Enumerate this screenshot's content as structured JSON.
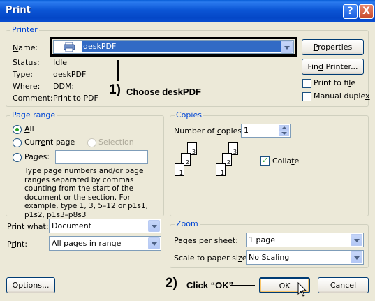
{
  "window": {
    "title": "Print",
    "help_glyph": "?",
    "close_glyph": "X"
  },
  "printer": {
    "group_label": "Printer",
    "name_label": "Name:",
    "name_value": "deskPDF",
    "status_label": "Status:",
    "status_value": "Idle",
    "type_label": "Type:",
    "type_value": "deskPDF",
    "where_label": "Where:",
    "where_value": "DDM:",
    "comment_label": "Comment:",
    "comment_value": "Print to PDF",
    "properties_label": "Properties",
    "find_printer_label": "Find Printer...",
    "print_to_file_label": "Print to file",
    "manual_duplex_label": "Manual duplex"
  },
  "page_range": {
    "group_label": "Page range",
    "all_label": "All",
    "current_page_label": "Current page",
    "selection_label": "Selection",
    "pages_label": "Pages:",
    "pages_value": "",
    "help_text": "Type page numbers and/or page ranges separated by commas counting from the start of the document or the section. For example, type 1, 3, 5–12 or p1s1, p1s2, p1s3–p8s3"
  },
  "copies": {
    "group_label": "Copies",
    "number_label": "Number of copies:",
    "number_value": "1",
    "collate_label": "Collate",
    "page_numbers": [
      "3",
      "2",
      "1",
      "3",
      "2",
      "1"
    ]
  },
  "print_what": {
    "label": "Print what:",
    "value": "Document"
  },
  "print": {
    "label": "Print:",
    "value": "All pages in range"
  },
  "zoom": {
    "group_label": "Zoom",
    "pages_per_sheet_label": "Pages per sheet:",
    "pages_per_sheet_value": "1 page",
    "scale_label": "Scale to paper size:",
    "scale_value": "No Scaling"
  },
  "buttons": {
    "options": "Options...",
    "ok": "OK",
    "cancel": "Cancel"
  },
  "annotations": {
    "step1_num": "1)",
    "step1_text": "Choose deskPDF",
    "step2_num": "2)",
    "step2_text": "Click “OK”"
  },
  "colors": {
    "title_bar": "#0b55d5",
    "dialog_bg": "#ece9d8",
    "group_label": "#0046d5",
    "selection": "#316ac5"
  }
}
